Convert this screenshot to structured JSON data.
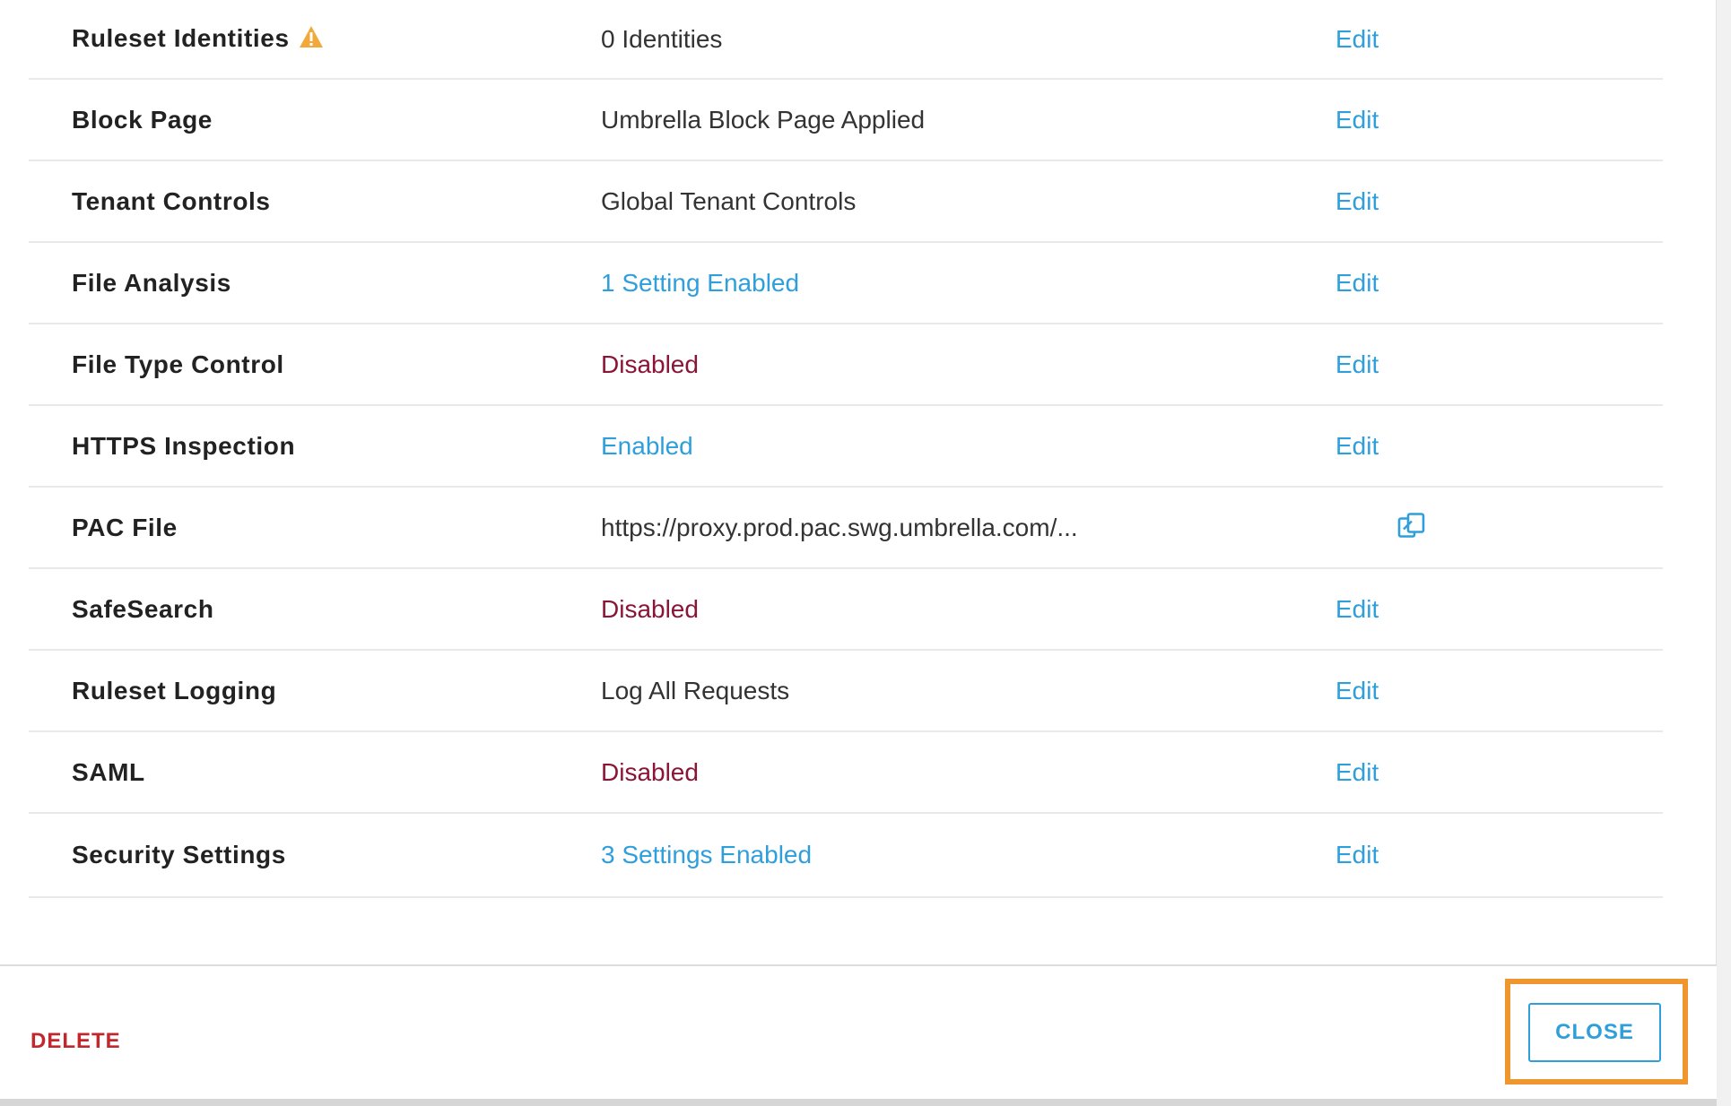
{
  "rows": [
    {
      "label": "Ruleset Identities",
      "value": "0 Identities",
      "edit": "Edit"
    },
    {
      "label": "Block Page",
      "value": "Umbrella Block Page Applied",
      "edit": "Edit"
    },
    {
      "label": "Tenant Controls",
      "value": "Global Tenant Controls",
      "edit": "Edit"
    },
    {
      "label": "File Analysis",
      "value": "1 Setting Enabled",
      "edit": "Edit"
    },
    {
      "label": "File Type Control",
      "value": "Disabled",
      "edit": "Edit"
    },
    {
      "label": "HTTPS Inspection",
      "value": "Enabled",
      "edit": "Edit"
    },
    {
      "label": "PAC File",
      "value": "https://proxy.prod.pac.swg.umbrella.com/..."
    },
    {
      "label": "SafeSearch",
      "value": "Disabled",
      "edit": "Edit"
    },
    {
      "label": "Ruleset Logging",
      "value": "Log All Requests",
      "edit": "Edit"
    },
    {
      "label": "SAML",
      "value": "Disabled",
      "edit": "Edit"
    },
    {
      "label": "Security Settings",
      "value": "3 Settings Enabled",
      "edit": "Edit"
    }
  ],
  "footer": {
    "delete_label": "DELETE",
    "close_label": "CLOSE"
  },
  "icons": {
    "warning": "warning-triangle-icon",
    "copy": "copy-icon"
  },
  "colors": {
    "link": "#2f9fdc",
    "disabled": "#8b1536",
    "delete": "#c1272d",
    "warning": "#f2a93b",
    "highlight": "#f0962e"
  }
}
